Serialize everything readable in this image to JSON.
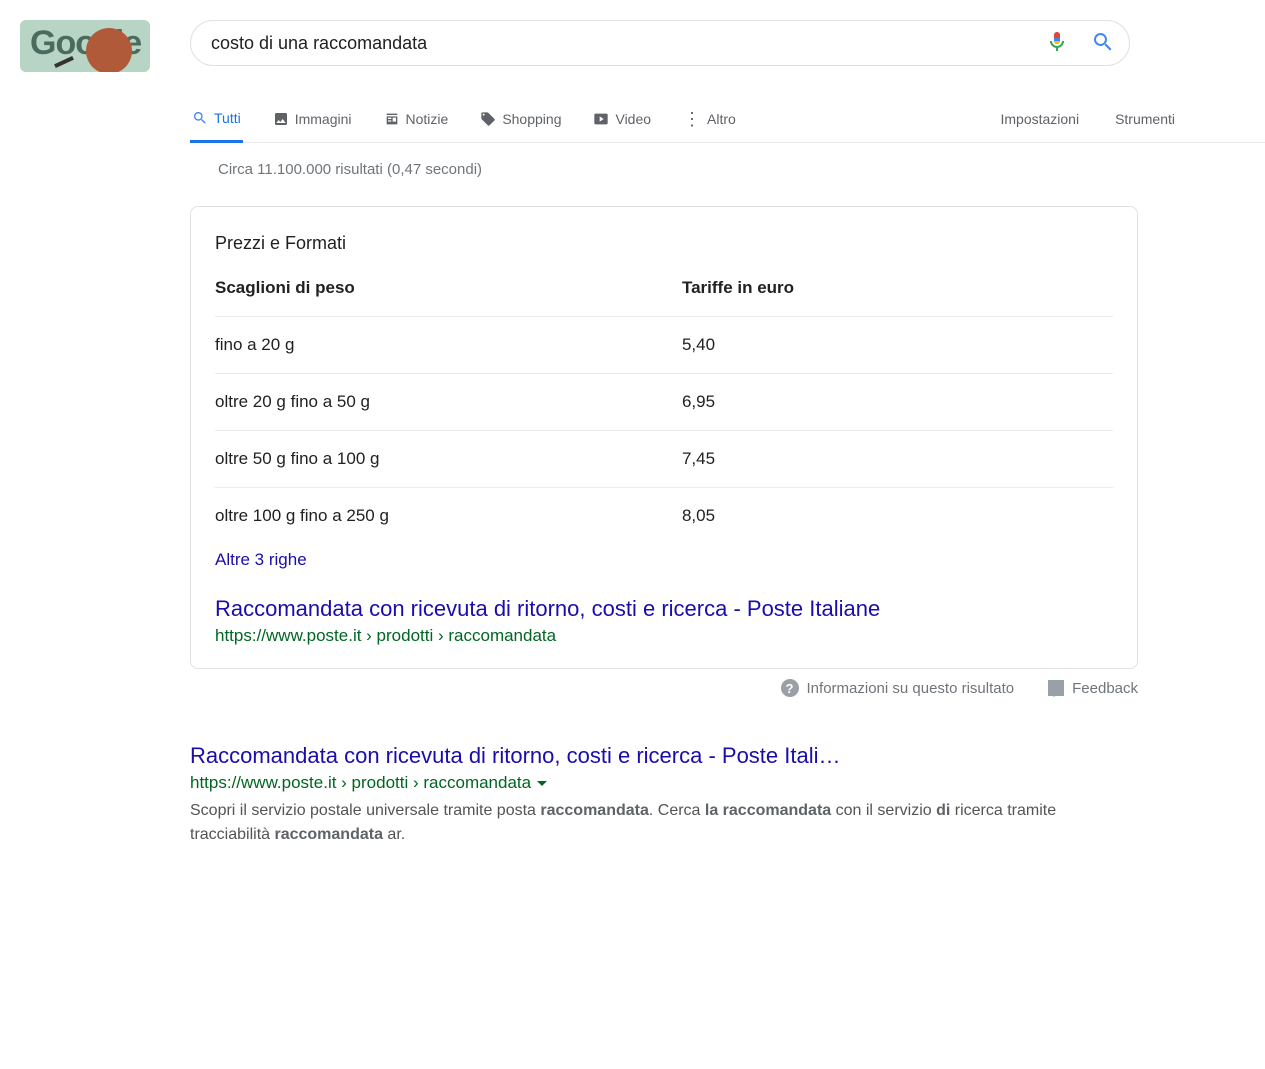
{
  "logo_text": "Google",
  "search": {
    "value": "costo di una raccomandata"
  },
  "tabs": {
    "all": "Tutti",
    "images": "Immagini",
    "news": "Notizie",
    "shopping": "Shopping",
    "video": "Video",
    "more": "Altro",
    "settings": "Impostazioni",
    "tools": "Strumenti"
  },
  "result_stats": "Circa 11.100.000 risultati (0,47 secondi)",
  "featured": {
    "heading": "Prezzi e Formati",
    "col1": "Scaglioni di peso",
    "col2": "Tariffe in euro",
    "rows": [
      {
        "c1": "fino a 20 g",
        "c2": "5,40"
      },
      {
        "c1": "oltre 20 g fino a 50 g",
        "c2": "6,95"
      },
      {
        "c1": "oltre 50 g fino a 100 g",
        "c2": "7,45"
      },
      {
        "c1": "oltre 100 g fino a 250 g",
        "c2": "8,05"
      }
    ],
    "more_rows": "Altre 3 righe",
    "title": "Raccomandata con ricevuta di ritorno, costi e ricerca - Poste Italiane",
    "url": "https://www.poste.it › prodotti › raccomandata",
    "about": "Informazioni su questo risultato",
    "feedback": "Feedback"
  },
  "organic1": {
    "title": "Raccomandata con ricevuta di ritorno, costi e ricerca - Poste Itali…",
    "url": "https://www.poste.it › prodotti › raccomandata",
    "snippet_pre": "Scopri il servizio postale universale tramite posta ",
    "snippet_b1": "raccomandata",
    "snippet_mid1": ". Cerca ",
    "snippet_b2": "la raccomandata",
    "snippet_mid2": " con il servizio ",
    "snippet_b3": "di",
    "snippet_mid3": " ricerca tramite tracciabilità ",
    "snippet_b4": "raccomandata",
    "snippet_post": " ar."
  }
}
